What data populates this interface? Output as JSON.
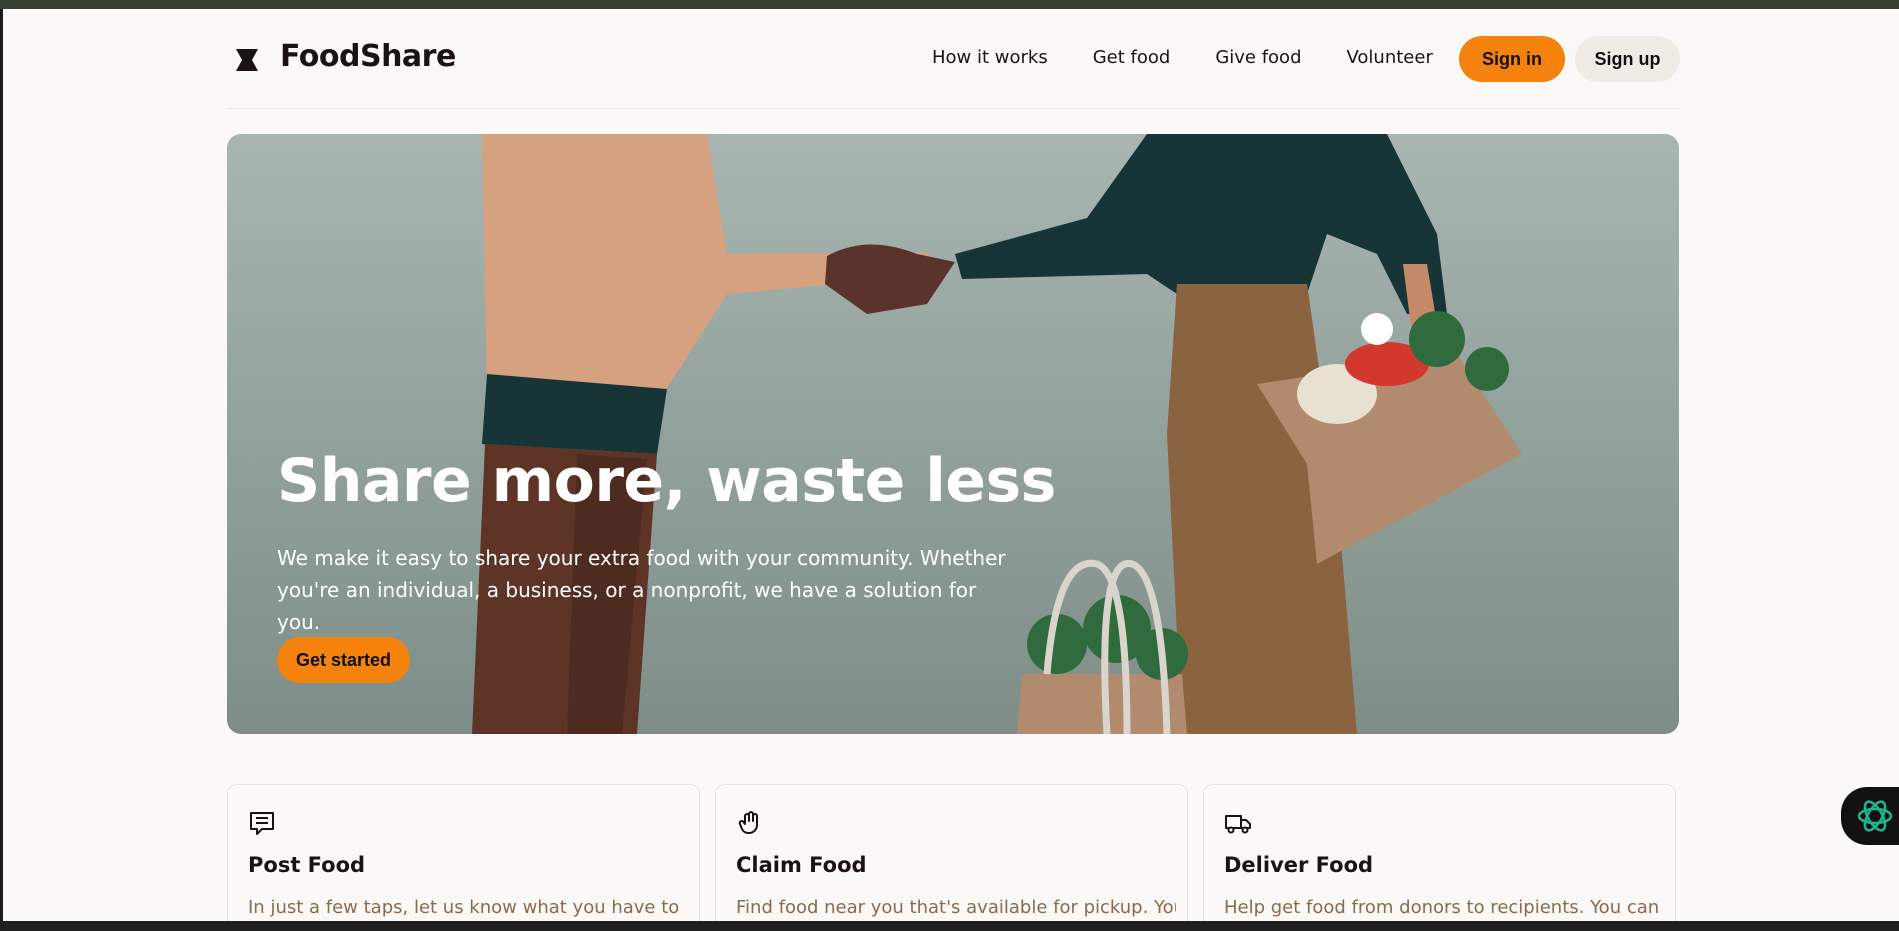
{
  "brand": {
    "name": "FoodShare",
    "logo_icon": "hourglass-logo-icon"
  },
  "nav": {
    "links": [
      "How it works",
      "Get food",
      "Give food",
      "Volunteer"
    ],
    "sign_in": "Sign in",
    "sign_up": "Sign up"
  },
  "hero": {
    "title": "Share more, waste less",
    "subtitle": "We make it easy to share your extra food with your community. Whether you're an individual, a business, or a nonprofit, we have a solution for you.",
    "cta": "Get started"
  },
  "cards": [
    {
      "icon": "receipt-icon",
      "title": "Post Food",
      "description": "In just a few taps, let us know what you have to"
    },
    {
      "icon": "hand-icon",
      "title": "Claim Food",
      "description": "Find food near you that's available for pickup. You"
    },
    {
      "icon": "truck-icon",
      "title": "Deliver Food",
      "description": "Help get food from donors to recipients. You can"
    }
  ],
  "widget": {
    "icon": "openai-assistant-icon"
  },
  "colors": {
    "accent": "#f4820c",
    "secondary_button": "#f1ebe5",
    "page_background": "#fbf9f7",
    "card_text": "#8a6a4c"
  }
}
